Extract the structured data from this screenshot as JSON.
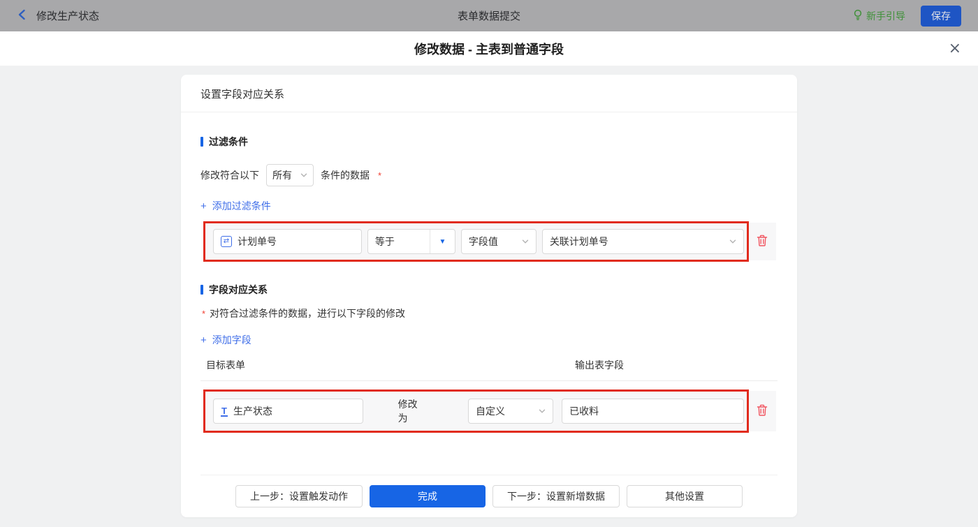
{
  "topbar": {
    "back_label": "修改生产状态",
    "title": "表单数据提交",
    "guide_label": "新手引导",
    "save_label": "保存"
  },
  "dialog": {
    "title": "修改数据 - 主表到普通字段",
    "close_glyph": "×"
  },
  "panel": {
    "header": "设置字段对应关系",
    "filter_section": {
      "title": "过滤条件",
      "match_prefix": "修改符合以下",
      "match_scope": "所有",
      "match_suffix": "条件的数据",
      "required_mark": "*",
      "add_link": {
        "plus": "+",
        "label": "添加过滤条件"
      },
      "row": {
        "field": "计划单号",
        "field_icon_glyph": "⇄",
        "operator": "等于",
        "value_type": "字段值",
        "value": "关联计划单号"
      }
    },
    "mapping_section": {
      "title": "字段对应关系",
      "required_mark": "*",
      "hint": "对符合过滤条件的数据，进行以下字段的修改",
      "add_link": {
        "plus": "+",
        "label": "添加字段"
      },
      "columns": {
        "target": "目标表单",
        "output": "输出表字段"
      },
      "row": {
        "field": "生产状态",
        "field_icon_glyph": "T",
        "action_label": "修改为",
        "mode": "自定义",
        "value": "已收料"
      }
    },
    "footer": {
      "prev_label": "上一步：设置触发动作",
      "done_label": "完成",
      "next_label": "下一步：设置新增数据",
      "other_label": "其他设置"
    }
  },
  "colors": {
    "primary_blue": "#1765e5",
    "link_blue": "#3f6ee8",
    "annotation_red": "#e12b1d",
    "trash_red": "#f15560",
    "guide_green": "#3f9138",
    "topbar_gray": "#a8a8aa"
  }
}
